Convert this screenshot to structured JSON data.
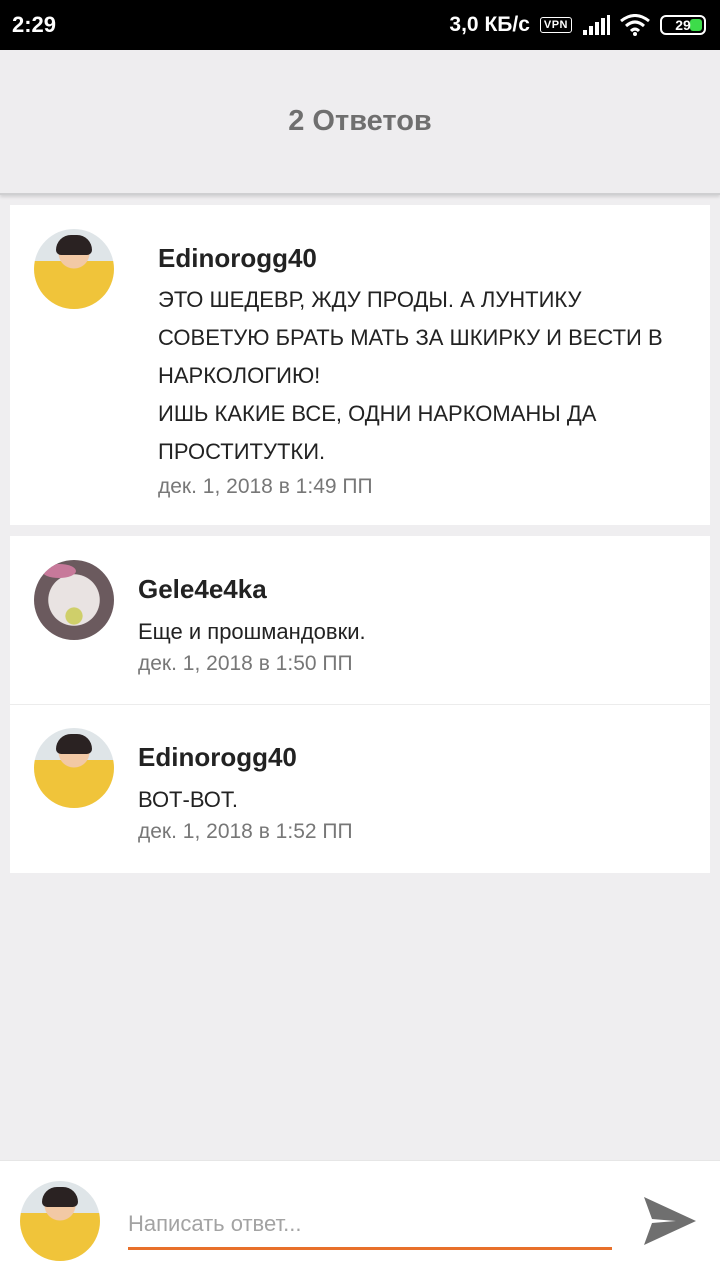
{
  "status_bar": {
    "time": "2:29",
    "speed": "3,0 КБ/с",
    "vpn": "VPN",
    "battery": "29",
    "battery_color": "#3ddc4a"
  },
  "header": {
    "title": "2 Ответов"
  },
  "parent_comment": {
    "author": "Edinorogg40",
    "text": "ЭТО ШЕДЕВР, ЖДУ ПРОДЫ. А ЛУНТИКУ СОВЕТУЮ БРАТЬ МАТЬ ЗА ШКИРКУ И ВЕСТИ В НАРКОЛОГИЮ!\nИШЬ КАКИЕ ВСЕ, ОДНИ НАРКОМАНЫ ДА ПРОСТИТУТКИ.",
    "date": "дек. 1, 2018 в 1:49 ПП"
  },
  "replies": [
    {
      "author": "Gele4e4ka",
      "text": "Еще и прошмандовки.",
      "date": "дек. 1, 2018 в 1:50 ПП"
    },
    {
      "author": "Edinorogg40",
      "text": "ВОТ-ВОТ.",
      "date": "дек. 1, 2018 в 1:52 ПП"
    }
  ],
  "composer": {
    "placeholder": "Написать ответ...",
    "value": "",
    "accent_color": "#e8702a",
    "send_icon": "send-icon"
  }
}
